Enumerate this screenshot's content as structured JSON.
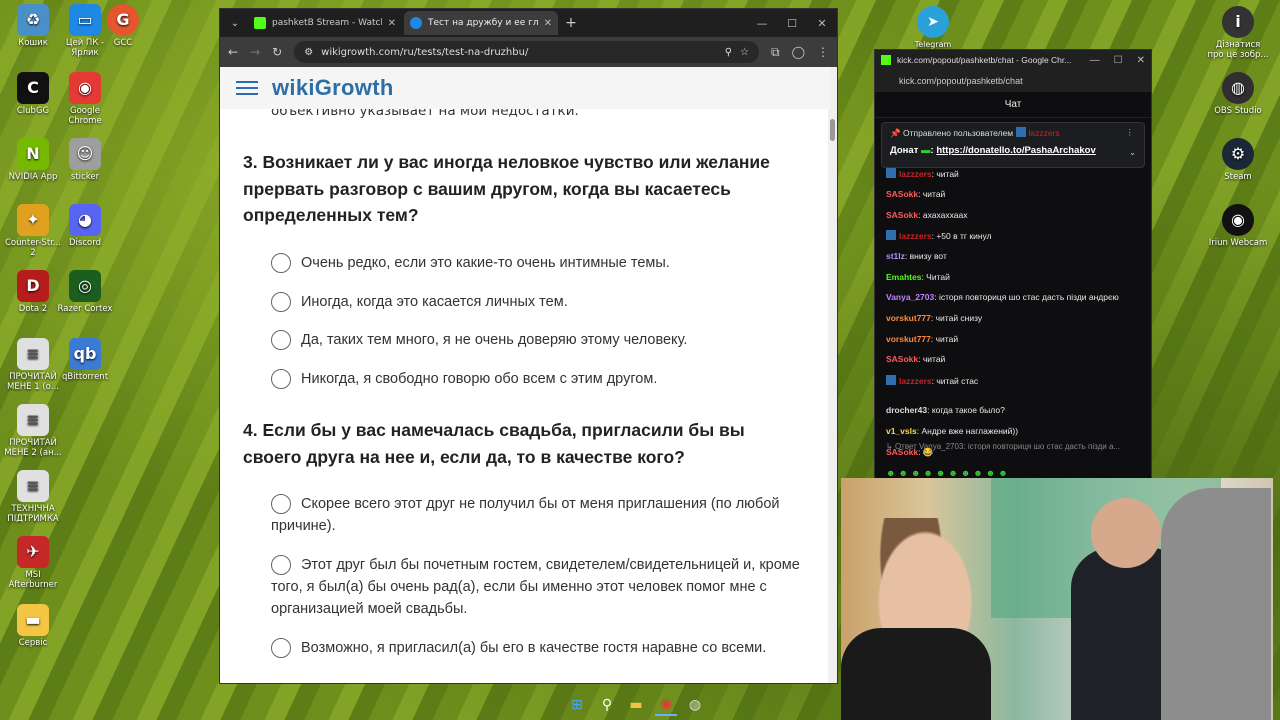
{
  "desktop_left": [
    {
      "label": "Кошик",
      "icon": "recycle-bin-icon",
      "glyph": "♻",
      "color": "#4a90c8"
    },
    {
      "label": "Цей ПК - Ярлик",
      "icon": "this-pc-icon",
      "glyph": "▭",
      "color": "#1e88e5"
    },
    {
      "label": "ClubGG",
      "icon": "clubgg-icon",
      "glyph": "C",
      "color": "#111"
    },
    {
      "label": "Google Chrome",
      "icon": "chrome-icon",
      "glyph": "◉",
      "color": "#e53935"
    },
    {
      "label": "NVIDIA App",
      "icon": "nvidia-icon",
      "glyph": "N",
      "color": "#76b900"
    },
    {
      "label": "sticker",
      "icon": "sticker-icon",
      "glyph": "☺",
      "color": "#9e9e9e"
    },
    {
      "label": "Counter-Str... 2",
      "icon": "cs2-icon",
      "glyph": "✦",
      "color": "#e0a020"
    },
    {
      "label": "Discord",
      "icon": "discord-icon",
      "glyph": "◕",
      "color": "#5865f2"
    },
    {
      "label": "Dota 2",
      "icon": "dota2-icon",
      "glyph": "D",
      "color": "#b71c1c"
    },
    {
      "label": "Razer Cortex",
      "icon": "razer-icon",
      "glyph": "◎",
      "color": "#1b5e20"
    },
    {
      "label": "ПРОЧИТАЙ МЕНЕ 1 (о...",
      "icon": "text-file-icon",
      "glyph": "≡",
      "color": "#e0e0e0"
    },
    {
      "label": "qBittorrent",
      "icon": "qbittorrent-icon",
      "glyph": "qb",
      "color": "#3a7bd5"
    },
    {
      "label": "ПРОЧИТАЙ МЕНЕ 2 (ан...",
      "icon": "text-file-icon",
      "glyph": "≡",
      "color": "#e0e0e0"
    },
    {
      "label": "ТЕХНІЧНА ПІДТРИМКА",
      "icon": "text-file-icon",
      "glyph": "≡",
      "color": "#e0e0e0"
    },
    {
      "label": "MSI Afterburner",
      "icon": "msi-icon",
      "glyph": "✈",
      "color": "#c62828"
    },
    {
      "label": "Сервіс",
      "icon": "folder-icon",
      "glyph": "▬",
      "color": "#f4c542"
    }
  ],
  "gcc_label": "GCC",
  "desktop_right": [
    {
      "label": "Дізнатися про це зобр...",
      "icon": "info-icon",
      "glyph": "i",
      "color": "#333"
    },
    {
      "label": "OBS Studio",
      "icon": "obs-icon",
      "glyph": "◍",
      "color": "#302e31"
    },
    {
      "label": "Steam",
      "icon": "steam-icon",
      "glyph": "⚙",
      "color": "#1b2838"
    },
    {
      "label": "Iriun Webcam",
      "icon": "iriun-icon",
      "glyph": "◉",
      "color": "#111"
    }
  ],
  "telegram_label": "Telegram",
  "browser": {
    "tabs": [
      {
        "title": "pashketB Stream - Watch Live o",
        "color": "#53fc18"
      },
      {
        "title": "Тест на дружбу и ее глубину",
        "color": "#1e88e5"
      }
    ],
    "url": "wikigrowth.com/ru/tests/test-na-druzhbu/"
  },
  "site": {
    "logo": "wikiGrowth",
    "prev_text": "объективно указывает на мои недостатки.",
    "q3": "3. Возникает ли у вас иногда неловкое чувство или желание прервать разговор с вашим другом, когда вы касаетесь определенных тем?",
    "q3_options": [
      "Очень редко, если это какие-то очень интимные темы.",
      "Иногда, когда это касается личных тем.",
      "Да, таких тем много, я не очень доверяю этому человеку.",
      "Никогда, я свободно говорю обо всем с этим другом."
    ],
    "q4": "4. Если бы у вас намечалась свадьба, пригласили бы вы своего друга на нее и, если да, то в качестве кого?",
    "q4_options": [
      "Скорее всего этот друг не получил бы от меня приглашения (по любой причине).",
      "Этот друг был бы почетным гостем, свидетелем/свидетельницей и, кроме того, я был(а) бы очень рад(а), если бы именно этот человек помог мне с организацией моей свадьбы.",
      "Возможно, я пригласил(а) бы его в качестве гостя наравне со всеми."
    ]
  },
  "chat": {
    "window_title": "kick.com/popout/pashketb/chat - Google Chr...",
    "url": "kick.com/popout/pashketb/chat",
    "header": "Чат",
    "pinned_by": "Отправлено пользователем",
    "pinned_user": "lazzzers",
    "pinned_prefix": "Донат",
    "pinned_link": "https://donatello.to/PashaArchakov",
    "messages": [
      {
        "user": "lazzzers",
        "text": "читай",
        "color": "#c22",
        "badge": true
      },
      {
        "user": "SASokk",
        "text": "читай",
        "color": "#ff5a5a",
        "badge": false
      },
      {
        "user": "SASokk",
        "text": "ахахаххаах",
        "color": "#ff5a5a",
        "badge": false
      },
      {
        "user": "lazzzers",
        "text": "+50 в тг кинул",
        "color": "#c22",
        "badge": true
      },
      {
        "user": "st1lz",
        "text": "внизу вот",
        "color": "#b58cff",
        "badge": false
      },
      {
        "user": "Emahtes",
        "text": "Читай",
        "color": "#53fc18",
        "badge": false
      },
      {
        "user": "Vanya_2703",
        "text": "історя повториця шо стас дасть пізди андрєю",
        "color": "#c084fc",
        "badge": false
      },
      {
        "user": "vorskut777",
        "text": "читай снизу",
        "color": "#ff8a3d",
        "badge": false
      },
      {
        "user": "vorskut777",
        "text": "читай",
        "color": "#ff8a3d",
        "badge": false
      },
      {
        "user": "SASokk",
        "text": "читай",
        "color": "#ff5a5a",
        "badge": false
      },
      {
        "user": "lazzzers",
        "text": "читай стас",
        "color": "#c22",
        "badge": true
      }
    ],
    "reply_note": "Ответ Vanya_2703: історя повториця шо стас дасть пізди а...",
    "messages2": [
      {
        "user": "drocher43",
        "text": "когда такое было?",
        "color": "#dddddd"
      },
      {
        "user": "v1_vsls",
        "text": "Андре вже наглажений))",
        "color": "#ffd54a"
      },
      {
        "user": "SASokk",
        "text": "😂",
        "color": "#ff5a5a"
      }
    ]
  }
}
